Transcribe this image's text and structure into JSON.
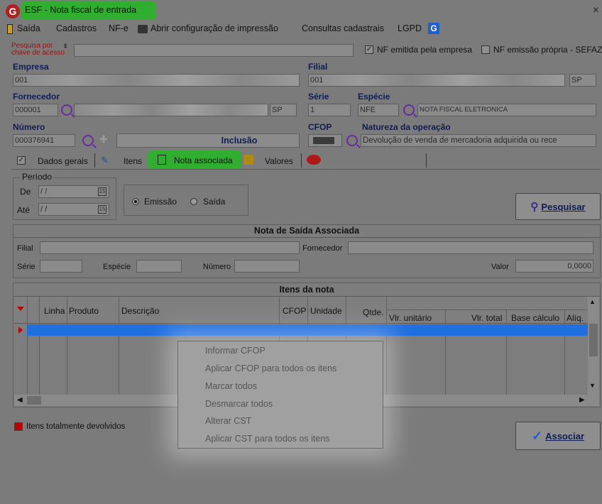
{
  "window": {
    "title": "ESF - Nota fiscal de entrada",
    "close": "×"
  },
  "menu": [
    "Saída",
    "Cadastros",
    "NF-e",
    "Abrir configuração de impressão",
    "Consultas cadastrais",
    "LGPD"
  ],
  "search": {
    "label": "Pesquisa por chave de acesso",
    "value": ""
  },
  "options": {
    "nf_emitida": "NF emitida pela empresa",
    "nf_propria": "NF emissão própria - SEFAZ"
  },
  "empresa": {
    "label": "Empresa",
    "code": "001"
  },
  "filial": {
    "label": "Filial",
    "code": "001",
    "uf": "SP"
  },
  "fornecedor": {
    "label": "Fornecedor",
    "code": "000001",
    "uf": "SP"
  },
  "serie": {
    "label": "Série",
    "value": "1"
  },
  "especie": {
    "label": "Espécie",
    "code": "NFE",
    "desc": "NOTA FISCAL ELETRONICA"
  },
  "numero": {
    "label": "Número",
    "value": "000376941",
    "status": "Inclusão"
  },
  "cfop": {
    "label": "CFOP"
  },
  "natureza": {
    "label": "Natureza da operação",
    "value": "Devolução de venda de mercadoria adquirida ou rece"
  },
  "tabs": [
    "Dados gerais",
    "Itens",
    "Nota associada",
    "Valores"
  ],
  "periodo": {
    "label": "Período",
    "de_label": "De",
    "ate_label": "Até",
    "de_value": "/ /",
    "ate_value": "/ /",
    "emissao": "Emissão",
    "saida": "Saída"
  },
  "pesquisar": "Pesquisar",
  "nota_saida": {
    "title": "Nota de Saída Associada",
    "filial": "Filial",
    "fornecedor": "Fornecedor",
    "serie": "Série",
    "especie": "Espécie",
    "numero": "Número",
    "valor_label": "Valor",
    "valor": "0,0000"
  },
  "itens": {
    "title": "Itens da nota",
    "columns": [
      "Linha",
      "Produto",
      "Descrição",
      "CFOP",
      "Unidade",
      "Qtde.",
      "Vlr. unitário",
      "Vlr. total",
      "Base cálculo",
      "Alíq."
    ]
  },
  "context_menu": [
    "Informar CFOP",
    "Aplicar CFOP para todos os itens",
    "Marcar todos",
    "Desmarcar todos",
    "Alterar CST",
    "Aplicar CST para todos os itens"
  ],
  "legend": "Itens totalmente devolvidos",
  "associar": "Associar",
  "colors": {
    "green_highlight": "#2fae2f",
    "row_select": "#1f6fe0",
    "accent_red": "#c00000"
  }
}
